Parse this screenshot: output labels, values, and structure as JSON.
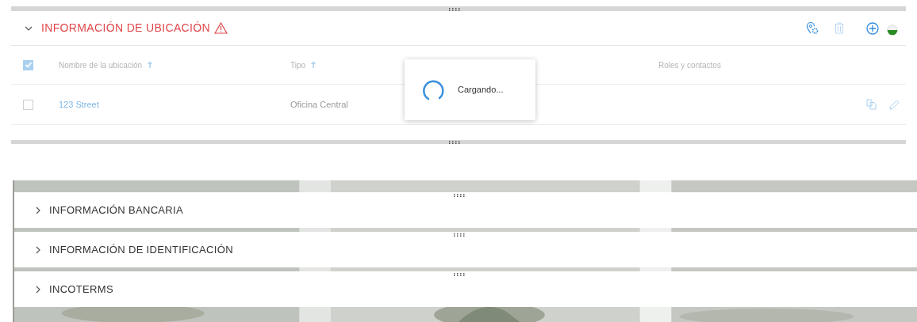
{
  "location_section": {
    "title": "INFORMACIÓN DE UBICACIÓN",
    "warning": true,
    "expanded": true,
    "table": {
      "select_all_checked": true,
      "columns": [
        {
          "label": "Nombre de la ubicación",
          "sortable": true
        },
        {
          "label": "Tipo",
          "sortable": true
        },
        {
          "label": "Roles y contactos",
          "sortable": false
        }
      ],
      "rows": [
        {
          "checked": false,
          "name": "123 Street",
          "type": "Oficina Central"
        }
      ]
    }
  },
  "loading": {
    "text": "Cargando..."
  },
  "sections": [
    {
      "title": "INFORMACIÓN BANCARIA",
      "expanded": false
    },
    {
      "title": "INFORMACIÓN DE IDENTIFICACIÓN",
      "expanded": false
    },
    {
      "title": "INCOTERMS",
      "expanded": false
    }
  ]
}
